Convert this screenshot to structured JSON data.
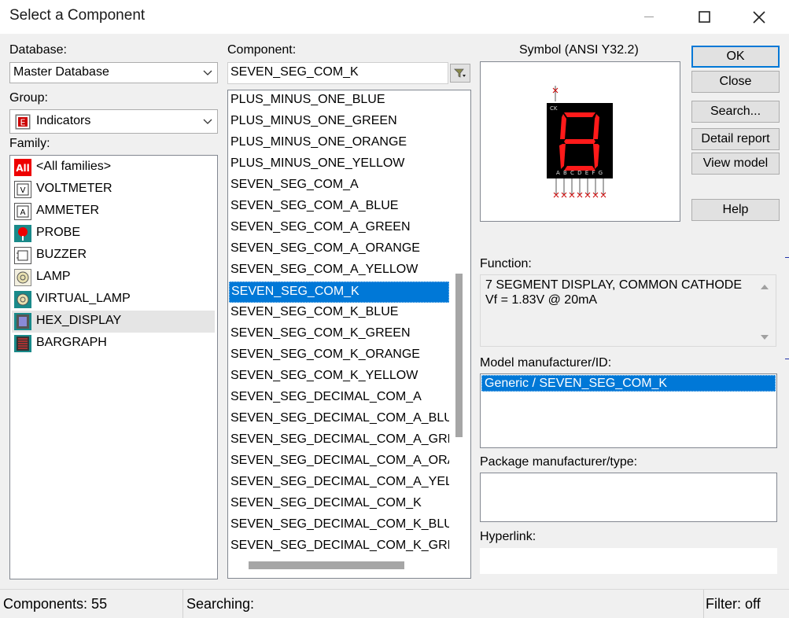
{
  "window": {
    "title": "Select a Component"
  },
  "database": {
    "label": "Database:",
    "value": "Master Database"
  },
  "group": {
    "label": "Group:",
    "value": "Indicators"
  },
  "family": {
    "label": "Family:",
    "items": [
      {
        "label": "<All families>",
        "icon": "all-families-icon"
      },
      {
        "label": "VOLTMETER",
        "icon": "voltmeter-icon"
      },
      {
        "label": "AMMETER",
        "icon": "ammeter-icon"
      },
      {
        "label": "PROBE",
        "icon": "probe-icon"
      },
      {
        "label": "BUZZER",
        "icon": "buzzer-icon"
      },
      {
        "label": "LAMP",
        "icon": "lamp-icon"
      },
      {
        "label": "VIRTUAL_LAMP",
        "icon": "virtual-lamp-icon"
      },
      {
        "label": "HEX_DISPLAY",
        "icon": "hex-display-icon"
      },
      {
        "label": "BARGRAPH",
        "icon": "bargraph-icon"
      }
    ],
    "selected": "HEX_DISPLAY",
    "all_icon_text": "All"
  },
  "component": {
    "label": "Component:",
    "search_value": "SEVEN_SEG_COM_K",
    "items": [
      "PLUS_MINUS_ONE_BLUE",
      "PLUS_MINUS_ONE_GREEN",
      "PLUS_MINUS_ONE_ORANGE",
      "PLUS_MINUS_ONE_YELLOW",
      "SEVEN_SEG_COM_A",
      "SEVEN_SEG_COM_A_BLUE",
      "SEVEN_SEG_COM_A_GREEN",
      "SEVEN_SEG_COM_A_ORANGE",
      "SEVEN_SEG_COM_A_YELLOW",
      "SEVEN_SEG_COM_K",
      "SEVEN_SEG_COM_K_BLUE",
      "SEVEN_SEG_COM_K_GREEN",
      "SEVEN_SEG_COM_K_ORANGE",
      "SEVEN_SEG_COM_K_YELLOW",
      "SEVEN_SEG_DECIMAL_COM_A",
      "SEVEN_SEG_DECIMAL_COM_A_BLUE",
      "SEVEN_SEG_DECIMAL_COM_A_GREEN",
      "SEVEN_SEG_DECIMAL_COM_A_ORANGE",
      "SEVEN_SEG_DECIMAL_COM_A_YELLOW",
      "SEVEN_SEG_DECIMAL_COM_K",
      "SEVEN_SEG_DECIMAL_COM_K_BLUE",
      "SEVEN_SEG_DECIMAL_COM_K_GREEN"
    ],
    "selected_index": 9
  },
  "symbol": {
    "label": "Symbol (ANSI Y32.2)",
    "ck_label": "CK",
    "pin_labels": "A B C D E F G",
    "digit_color": "#ff1a1a"
  },
  "buttons": {
    "ok": "OK",
    "close": "Close",
    "search": "Search...",
    "detail_report": "Detail report",
    "view_model": "View model",
    "help": "Help"
  },
  "function": {
    "label": "Function:",
    "line1": "7 SEGMENT DISPLAY, COMMON CATHODE",
    "line2": "Vf = 1.83V @ 20mA"
  },
  "model": {
    "label": "Model manufacturer/ID:",
    "selected": "Generic / SEVEN_SEG_COM_K"
  },
  "package": {
    "label": "Package manufacturer/type:"
  },
  "hyperlink": {
    "label": "Hyperlink:"
  },
  "status": {
    "components": "Components: 55",
    "searching": "Searching:",
    "filter": "Filter: off"
  },
  "colors": {
    "selection": "#0078d7",
    "accent_red": "#ff1a1a"
  }
}
